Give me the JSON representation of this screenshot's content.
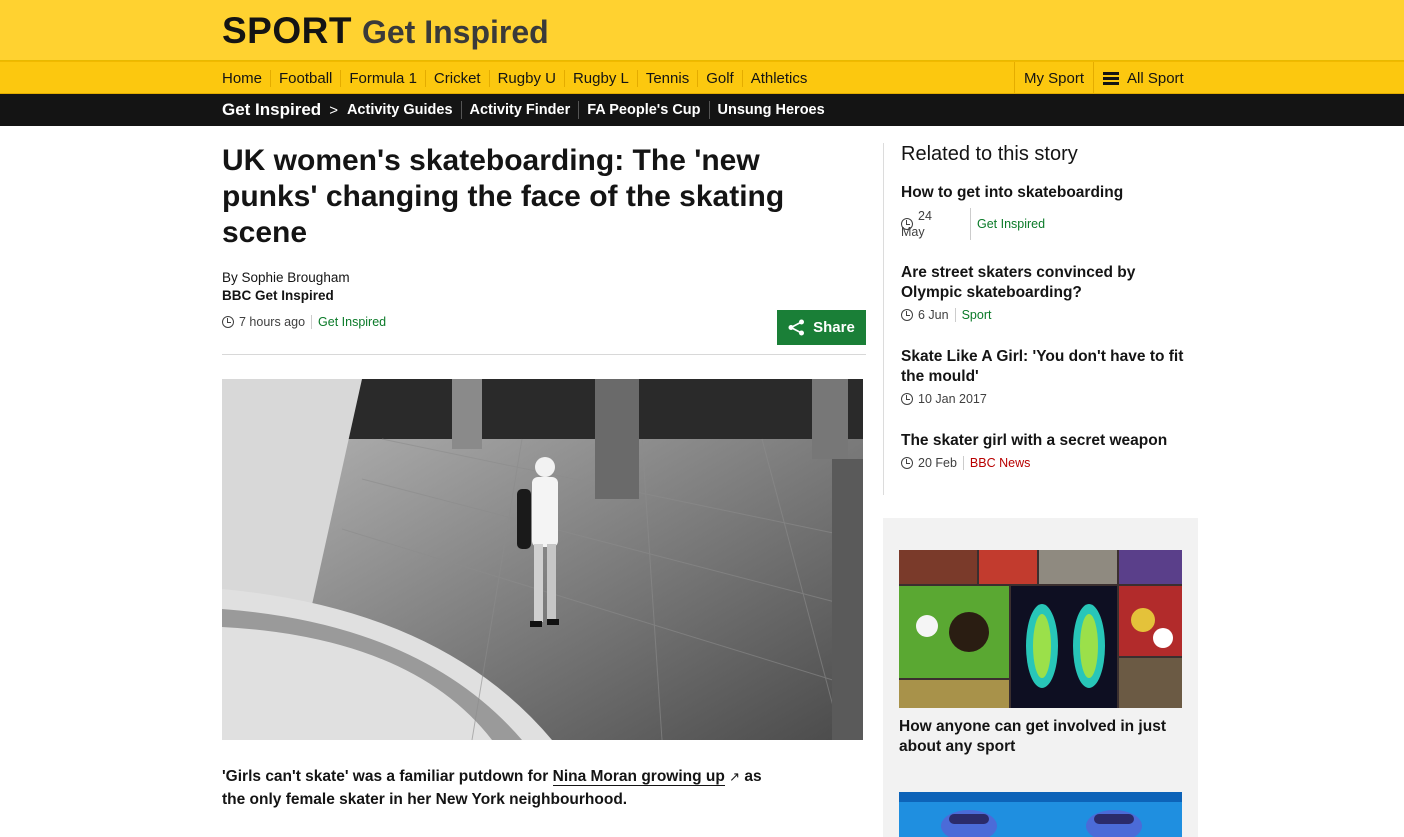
{
  "header": {
    "brand_sport": "SPORT",
    "brand_section": "Get Inspired"
  },
  "nav": {
    "items": [
      "Home",
      "Football",
      "Formula 1",
      "Cricket",
      "Rugby U",
      "Rugby L",
      "Tennis",
      "Golf",
      "Athletics"
    ],
    "my_sport": "My Sport",
    "all_sport": "All Sport"
  },
  "subnav": {
    "root": "Get Inspired",
    "links": [
      "Activity Guides",
      "Activity Finder",
      "FA People's Cup",
      "Unsung Heroes"
    ]
  },
  "article": {
    "headline": "UK women's skateboarding: The 'new punks' changing the face of the skating scene",
    "author": "By Sophie Brougham",
    "org": "BBC Get Inspired",
    "time": "7 hours ago",
    "section": "Get Inspired",
    "share_label": "Share",
    "lead_before": "'Girls can't skate' was a familiar putdown for ",
    "lead_link": "Nina Moran growing up",
    "lead_after": " as the only female skater in her New York neighbourhood."
  },
  "related": {
    "title": "Related to this story",
    "items": [
      {
        "title": "How to get into skateboarding",
        "date_line1": "24",
        "date_line2": "May",
        "tag": "Get Inspired"
      },
      {
        "title": "Are street skaters convinced by Olympic skateboarding?",
        "date": "6 Jun",
        "tag": "Sport"
      },
      {
        "title": "Skate Like A Girl: 'You don't have to fit the mould'",
        "date": "10 Jan 2017"
      },
      {
        "title": "The skater girl with a secret weapon",
        "date": "20 Feb",
        "tag": "BBC News"
      }
    ]
  },
  "promo": {
    "title": "How anyone can get involved in just about any sport"
  },
  "colors": {
    "header": "#ffd230",
    "nav": "#fcc80f",
    "subnav": "#141414",
    "green": "#1a7f37",
    "red": "#b80000"
  },
  "icons": [
    "clock-icon",
    "share-icon",
    "menu-icon",
    "external-link-icon",
    "chevron-right-icon"
  ]
}
